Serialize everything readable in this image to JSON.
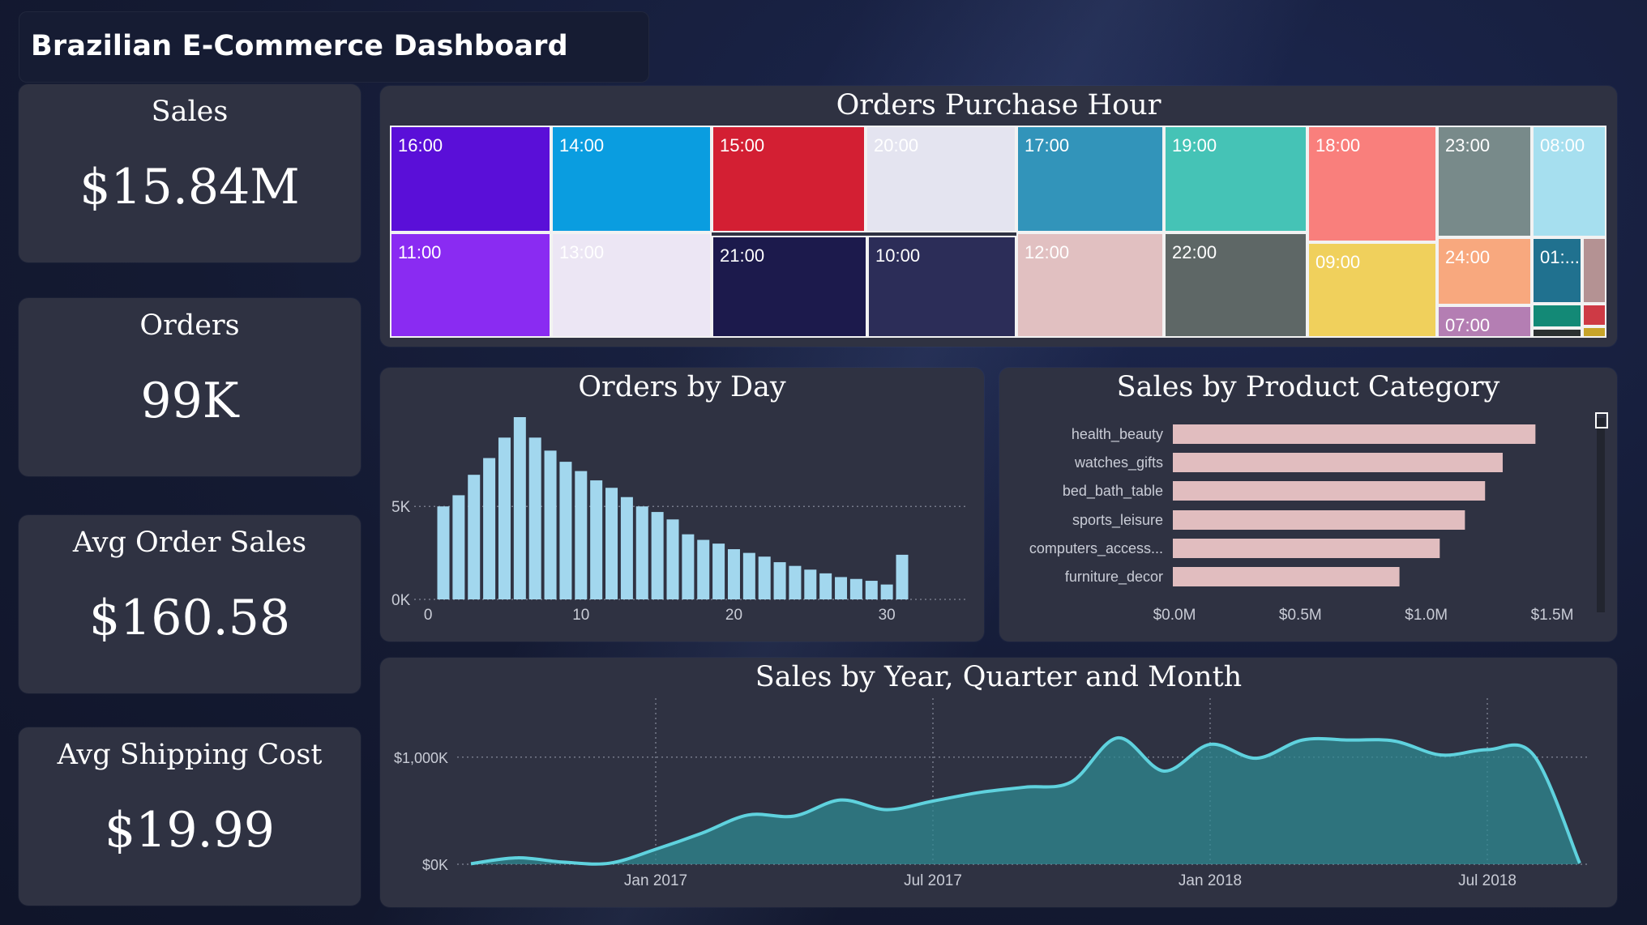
{
  "dashboard_title": "Brazilian E-Commerce Dashboard",
  "kpis": [
    {
      "label": "Sales",
      "value": "$15.84M"
    },
    {
      "label": "Orders",
      "value": "99K"
    },
    {
      "label": "Avg Order Sales",
      "value": "$160.58"
    },
    {
      "label": "Avg Shipping Cost",
      "value": "$19.99"
    }
  ],
  "chart_data": [
    {
      "type": "treemap",
      "title": "Orders Purchase Hour",
      "cells": [
        {
          "label": "16:00",
          "color": "#5a0fd8",
          "text": "#ffffff"
        },
        {
          "label": "14:00",
          "color": "#0a9de0",
          "text": "#ffffff"
        },
        {
          "label": "15:00",
          "color": "#d31f33",
          "text": "#ffffff"
        },
        {
          "label": "20:00",
          "color": "#e4e4f0",
          "text": "#ffffff"
        },
        {
          "label": "17:00",
          "color": "#3294ba",
          "text": "#ffffff"
        },
        {
          "label": "19:00",
          "color": "#45c3b6",
          "text": "#ffffff"
        },
        {
          "label": "18:00",
          "color": "#f97f7c",
          "text": "#ffffff"
        },
        {
          "label": "23:00",
          "color": "#788a8a",
          "text": "#ffffff"
        },
        {
          "label": "08:00",
          "color": "#a6dfef",
          "text": "#ffffff"
        },
        {
          "label": "11:00",
          "color": "#8a2bf2",
          "text": "#ffffff"
        },
        {
          "label": "13:00",
          "color": "#ece6f4",
          "text": "#ffffff"
        },
        {
          "label": "21:00",
          "color": "#1c1a4c",
          "text": "#ffffff"
        },
        {
          "label": "10:00",
          "color": "#2c2d58",
          "text": "#ffffff"
        },
        {
          "label": "12:00",
          "color": "#e1c0c1",
          "text": "#ffffff"
        },
        {
          "label": "22:00",
          "color": "#5e6766",
          "text": "#ffffff"
        },
        {
          "label": "09:00",
          "color": "#f0d05c",
          "text": "#ffffff"
        },
        {
          "label": "24:00",
          "color": "#f8a87e",
          "text": "#ffffff"
        },
        {
          "label": "01:...",
          "color": "#20718f",
          "text": "#ffffff"
        },
        {
          "label": "07:00",
          "color": "#b47eb3",
          "text": "#ffffff"
        },
        {
          "label": "",
          "color": "#b49293",
          "text": "#ffffff"
        },
        {
          "label": "",
          "color": "#138976",
          "text": "#ffffff"
        },
        {
          "label": "",
          "color": "#ce3a45",
          "text": "#ffffff"
        },
        {
          "label": "",
          "color": "#2b3030",
          "text": "#ffffff"
        },
        {
          "label": "",
          "color": "#c7a42a",
          "text": "#ffffff"
        }
      ]
    },
    {
      "type": "bar",
      "title": "Orders by Day",
      "x": [
        1,
        2,
        3,
        4,
        5,
        6,
        7,
        8,
        9,
        10,
        11,
        12,
        13,
        14,
        15,
        16,
        17,
        18,
        19,
        20,
        21,
        22,
        23,
        24,
        25,
        26,
        27,
        28,
        29,
        30,
        31
      ],
      "values": [
        5000,
        5600,
        6700,
        7600,
        8700,
        9800,
        8700,
        8000,
        7400,
        6900,
        6400,
        6000,
        5500,
        5000,
        4700,
        4300,
        3500,
        3200,
        3000,
        2700,
        2500,
        2300,
        2000,
        1800,
        1600,
        1400,
        1200,
        1100,
        1000,
        800,
        2400
      ],
      "xticks": [
        "0",
        "10",
        "20",
        "30"
      ],
      "yticks": [
        "0K",
        "5K"
      ],
      "ylim": [
        0,
        9800
      ],
      "color": "#a2d7ee"
    },
    {
      "type": "bar",
      "orientation": "horizontal",
      "title": "Sales by Product Category",
      "categories": [
        "health_beauty",
        "watches_gifts",
        "bed_bath_table",
        "sports_leisure",
        "computers_access...",
        "furniture_decor"
      ],
      "values": [
        1.44,
        1.31,
        1.24,
        1.16,
        1.06,
        0.9
      ],
      "xticks": [
        "$0.0M",
        "$0.5M",
        "$1.0M",
        "$1.5M"
      ],
      "xlim": [
        0,
        1.5
      ],
      "color": "#e1bdbf"
    },
    {
      "type": "area",
      "title": "Sales by Year, Quarter and Month",
      "x": [
        "2016-09",
        "2016-10",
        "2016-11",
        "2016-12",
        "2017-01",
        "2017-02",
        "2017-03",
        "2017-04",
        "2017-05",
        "2017-06",
        "2017-07",
        "2017-08",
        "2017-09",
        "2017-10",
        "2017-11",
        "2017-12",
        "2018-01",
        "2018-02",
        "2018-03",
        "2018-04",
        "2018-05",
        "2018-06",
        "2018-07",
        "2018-08",
        "2018-09"
      ],
      "values": [
        5,
        60,
        20,
        10,
        140,
        290,
        460,
        450,
        600,
        510,
        590,
        670,
        720,
        770,
        1180,
        870,
        1120,
        990,
        1160,
        1160,
        1150,
        1020,
        1070,
        1020,
        10
      ],
      "xticks": [
        "Jan 2017",
        "Jul 2017",
        "Jan 2018",
        "Jul 2018"
      ],
      "yticks": [
        "$0K",
        "$1,000K"
      ],
      "ylim": [
        0,
        1180
      ],
      "line_color": "#5fd2de",
      "fill_color": "#2f8a91"
    }
  ]
}
